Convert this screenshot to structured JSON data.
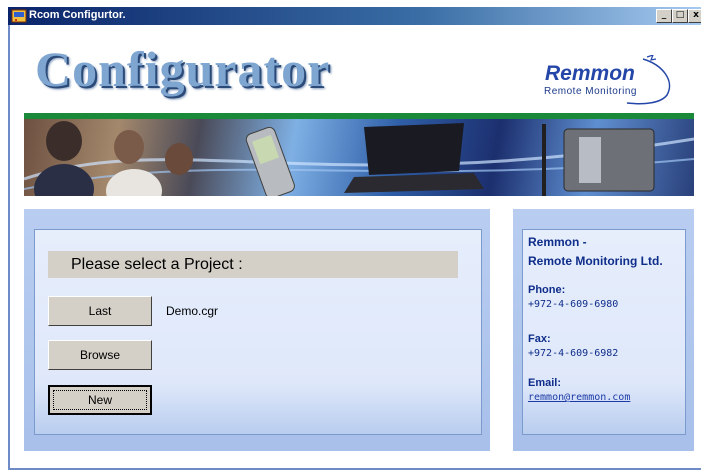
{
  "window": {
    "title": "Rcom Configurtor.",
    "minimize": "_",
    "maximize": "□",
    "close": "x"
  },
  "header": {
    "title": "Configurator",
    "logo_name": "Remmon",
    "logo_tagline": "Remote Monitoring"
  },
  "project": {
    "prompt": "Please select a Project :",
    "buttons": {
      "last": "Last",
      "browse": "Browse",
      "new": "New"
    },
    "last_file": "Demo.cgr"
  },
  "contact": {
    "company_line1": "Remmon -",
    "company_line2": "Remote Monitoring Ltd.",
    "phone_label": "Phone:",
    "phone": "+972-4-609-6980",
    "fax_label": "Fax:",
    "fax": "+972-4-609-6982",
    "email_label": "Email:",
    "email": "remmon@remmon.com"
  },
  "colors": {
    "titlebar": "#0a246a",
    "brand_blue": "#2446a8",
    "green_bar": "#1a8a3a",
    "panel": "#dfe8fa"
  }
}
